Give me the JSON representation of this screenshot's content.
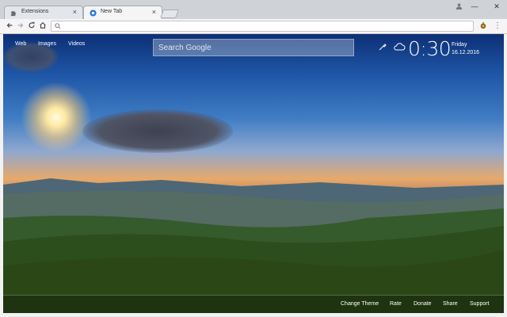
{
  "browser": {
    "tabs": [
      {
        "title": "Extensions",
        "close": "×"
      },
      {
        "title": "New Tab",
        "close": "×"
      }
    ],
    "omnibox": {
      "value": "",
      "placeholder": ""
    },
    "window_controls": {
      "minimize": "—",
      "close": "✕"
    },
    "extension_badge": "5",
    "menu_glyph": "⋮"
  },
  "page": {
    "nav_links": [
      "Web",
      "Images",
      "Videos"
    ],
    "search": {
      "placeholder": "Search Google"
    },
    "clock": {
      "time": "0:30",
      "day": "Friday",
      "date": "16.12.2016"
    },
    "footer_links": [
      "Change Theme",
      "Rate",
      "Donate",
      "Share",
      "Support"
    ]
  },
  "colors": {
    "accent": "#1a73e8",
    "sky_top": "#0d2f74",
    "sky_horizon": "#e7a96a"
  }
}
